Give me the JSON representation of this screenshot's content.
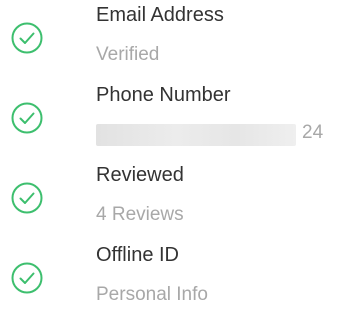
{
  "accent_color": "#3dbf6e",
  "verifications": [
    {
      "icon": "check-circle-icon",
      "title": "Email Address",
      "subtitle": "Verified"
    },
    {
      "icon": "check-circle-icon",
      "title": "Phone Number",
      "subtitle_masked": true,
      "subtitle_suffix": "24"
    },
    {
      "icon": "check-circle-icon",
      "title": "Reviewed",
      "subtitle": "4 Reviews"
    },
    {
      "icon": "check-circle-icon",
      "title": "Offline ID",
      "subtitle": "Personal Info"
    }
  ]
}
